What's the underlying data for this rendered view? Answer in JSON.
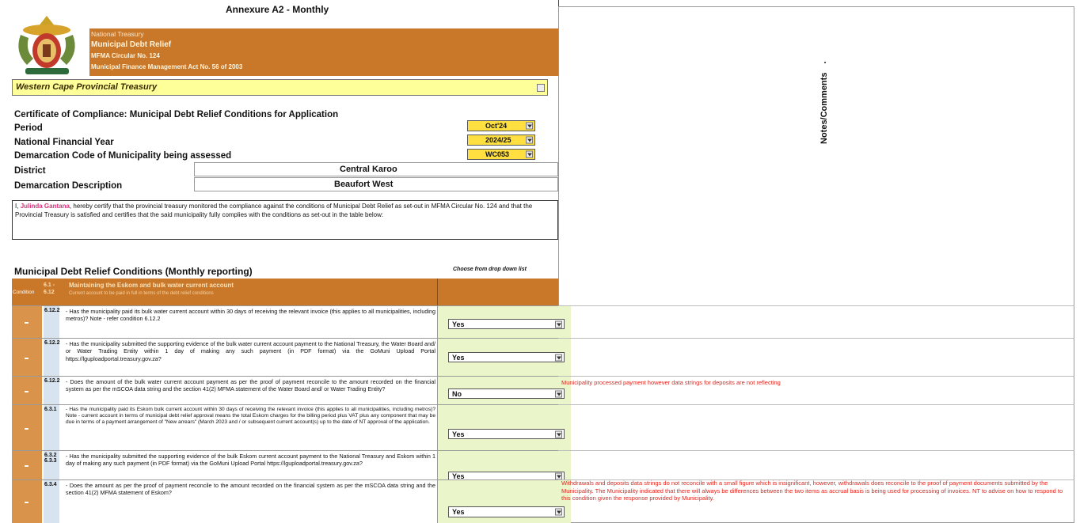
{
  "header": {
    "annex_title": "Annexure A2 - Monthly",
    "org": "National Treasury",
    "relief_title": "Municipal Debt Relief",
    "circular": "MFMA Circular No. 124",
    "act": "Municipal Finance Management Act No. 56 of 2003",
    "province": "Western Cape Provincial Treasury"
  },
  "certificate": {
    "title": "Certificate of Compliance: Municipal Debt Relief Conditions for Application",
    "period_label": "Period",
    "period_value": "Oct'24",
    "fin_year_label": "National Financial Year",
    "fin_year_value": "2024/25",
    "demarcation_code_label": "Demarcation Code of Municipality being assessed",
    "demarcation_code_value": "WC053",
    "district_label": "District",
    "district_value": "Central Karoo",
    "demarcation_desc_label": "Demarcation Description",
    "demarcation_desc_value": "Beaufort West"
  },
  "statement": {
    "prefix": "I,",
    "name": "Julinda Gantana",
    "text": ", hereby certify that the provincial treasury monitored the compliance against the conditions of Municipal Debt Relief as set-out in MFMA Circular No. 124 and that the Provincial Treasury is satisfied and certifies that the said municipality fully complies with the conditions as set-out in the table below:"
  },
  "conditions": {
    "title": "Municipal Debt Relief Conditions (Monthly reporting)",
    "choose_hint": "Choose from drop down list",
    "header_condition": "Condition",
    "header_ref": "6.1 - 6.12",
    "header_text": "Maintaining the Eskom and bulk water current account",
    "header_sub": "Current account to be paid in full in terms of the debt relief conditions"
  },
  "notes_title": "Notes/Comments",
  "rows": [
    {
      "ref": "6.12.2",
      "text": "- Has the municipality paid its bulk water current account within 30 days of receiving the relevant invoice (this applies to all municipalities, including metros)? Note - refer condition 6.12.2",
      "answer": "Yes",
      "note": ""
    },
    {
      "ref": "6.12.2",
      "text": "- Has the municipality submitted the supporting evidence of the bulk water current account payment to the National Treasury, the Water Board and/ or Water Trading Entity within 1 day of making any such payment (in PDF format) via the GoMuni Upload Portal https://lguploadportal.treasury.gov.za?",
      "answer": "Yes",
      "note": ""
    },
    {
      "ref": "6.12.2",
      "text": "- Does the amount of the bulk water current account payment as per the proof of payment reconcile to the amount recorded on the financial system as per the mSCOA data string and the section 41(2) MFMA statement of the Water Board and/ or Water Trading Entity?",
      "answer": "No",
      "note": "Municipality processed payment however data strings for deposits are not reflecting"
    },
    {
      "ref": "6.3.1",
      "text": "- Has the municipality paid its Eskom bulk current account within 30 days of receiving the relevant invoice (this applies to all municipalities, including metros)? Note - current account in terms of municipal debt relief approval means the total Eskom charges for the billing period plus VAT plus any component that may be due in terms of a payment arrangement of \"New arrears\" (March 2023 and / or subsequent current account(s) up to the date of NT approval of the application.",
      "answer": "Yes",
      "note": ""
    },
    {
      "ref": "6.3.2 6.3.3",
      "text": "- Has the municipality submitted the supporting evidence of the bulk Eskom current account payment to the National Treasury and Eskom within 1 day of making any such payment (in PDF format) via the GoMuni Upload Portal https://lguploadportal.treasury.gov.za?",
      "answer": "Yes",
      "note": ""
    },
    {
      "ref": "6.3.4",
      "text": "- Does the amount as per the proof of payment reconcile to the amount recorded on the financial system as per the mSCOA data string and the section 41(2) MFMA statement of Eskom?",
      "answer": "Yes",
      "note": "Withdrawals and deposits data strings do not reconcile with a small figure which is insignificant, however, withdrawals does reconcile to the proof of payment documents submitted by the Municipality. The Municipality indicated that there will always be differences between the two items as accrual basis is being used for processing of invoices. NT to advise on how to respond to this condition given the response provided by Municipality."
    }
  ],
  "colors": {
    "orange": "#c9782a",
    "yellow_bar": "#ffff99",
    "green_cell": "#eaf5c9",
    "note_red": "#e0251d",
    "name_pink": "#d6337a"
  }
}
